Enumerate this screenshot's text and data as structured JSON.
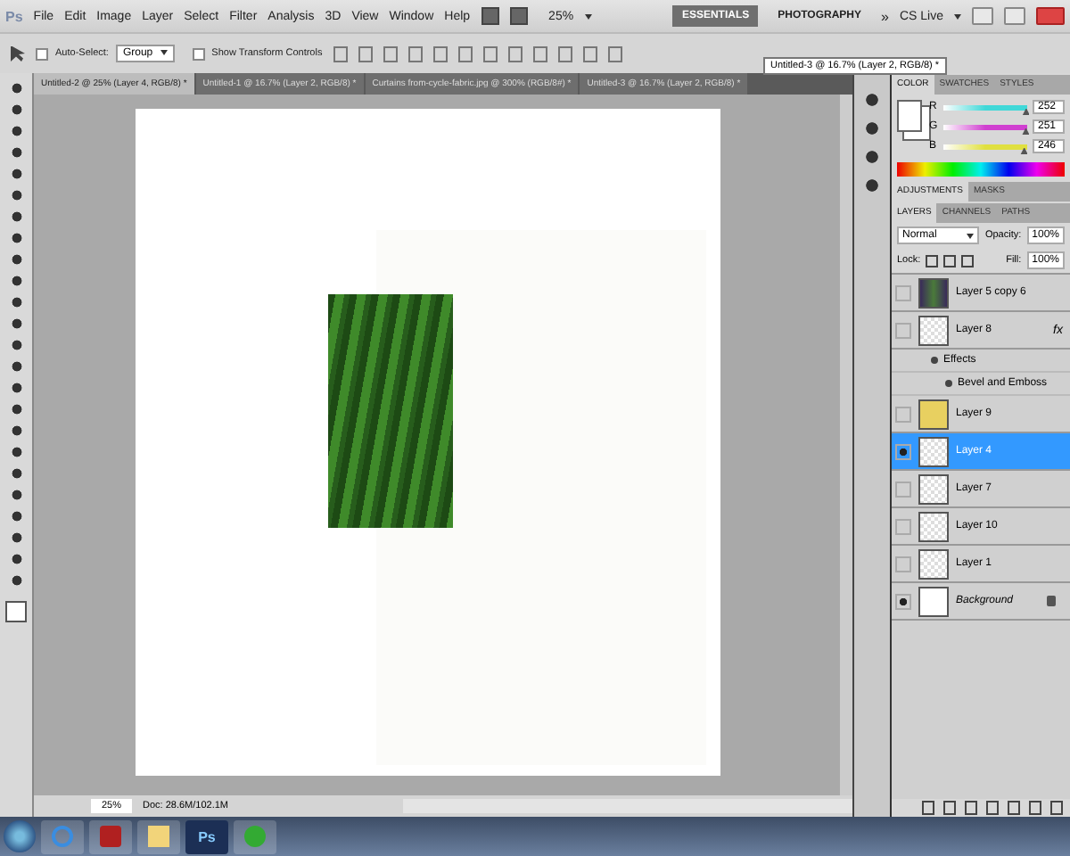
{
  "app_logo": "Ps",
  "menu": [
    "File",
    "Edit",
    "Image",
    "Layer",
    "Select",
    "Filter",
    "Analysis",
    "3D",
    "View",
    "Window",
    "Help"
  ],
  "zoom_menu": "25%",
  "workspaces": [
    {
      "label": "ESSENTIALS",
      "selected": true
    },
    {
      "label": "PHOTOGRAPHY",
      "selected": false
    }
  ],
  "more": "»",
  "cs_live": "CS Live",
  "options": {
    "auto_select": {
      "label": "Auto-Select:",
      "checked": false
    },
    "target": "Group",
    "transform": {
      "label": "Show Transform Controls",
      "checked": false
    }
  },
  "doc_tabs": [
    {
      "label": "Untitled-2 @ 25% (Layer 4, RGB/8) *",
      "selected": true
    },
    {
      "label": "Untitled-1 @ 16.7% (Layer 2, RGB/8) *",
      "selected": false
    },
    {
      "label": "Curtains from-cycle-fabric.jpg @ 300% (RGB/8#) *",
      "selected": false
    },
    {
      "label": "Untitled-3 @ 16.7% (Layer 2, RGB/8) *",
      "selected": false
    }
  ],
  "tooltip": "Untitled-3 @ 16.7% (Layer 2, RGB/8) *",
  "color_panel": {
    "tabs": [
      {
        "label": "COLOR",
        "selected": true
      },
      {
        "label": "SWATCHES",
        "selected": false
      },
      {
        "label": "STYLES",
        "selected": false
      }
    ],
    "channels": [
      {
        "name": "R",
        "level": 0.988,
        "reading": "252",
        "color": "#40d8d8"
      },
      {
        "name": "G",
        "level": 0.984,
        "reading": "251",
        "color": "#d040d0"
      },
      {
        "name": "B",
        "level": 0.965,
        "reading": "246",
        "color": "#e0e040"
      }
    ]
  },
  "adjust_tabs": [
    {
      "label": "ADJUSTMENTS",
      "selected": true
    },
    {
      "label": "MASKS",
      "selected": false
    }
  ],
  "layers_panel": {
    "tabs": [
      {
        "label": "LAYERS",
        "selected": true
      },
      {
        "label": "CHANNELS",
        "selected": false
      },
      {
        "label": "PATHS",
        "selected": false
      }
    ],
    "blend": "Normal",
    "opacity_label": "Opacity:",
    "opacity": "100%",
    "lock_label": "Lock:",
    "fill_label": "Fill:",
    "fill": "100%",
    "layers": [
      {
        "name": "Layer 5 copy 6",
        "kind": "photo",
        "visible": false,
        "selected": false,
        "locked": false
      },
      {
        "name": "Layer 8",
        "kind": "empty",
        "visible": false,
        "selected": false,
        "fx_label": "fx",
        "locked": false,
        "children": [
          {
            "name": "Effects"
          },
          {
            "name": "Bevel and Emboss"
          }
        ]
      },
      {
        "name": "Layer 9",
        "kind": "yellow",
        "visible": false,
        "selected": false,
        "locked": false
      },
      {
        "name": "Layer 4",
        "kind": "empty",
        "visible": true,
        "selected": true,
        "locked": false
      },
      {
        "name": "Layer 7",
        "kind": "empty",
        "visible": false,
        "selected": false,
        "locked": false
      },
      {
        "name": "Layer 10",
        "kind": "empty",
        "visible": false,
        "selected": false,
        "locked": false
      },
      {
        "name": "Layer 1",
        "kind": "empty",
        "visible": false,
        "selected": false,
        "locked": false
      },
      {
        "name": "Background",
        "kind": "white",
        "visible": true,
        "selected": false,
        "locked": true
      }
    ]
  },
  "status": {
    "zoom": "25%",
    "doc": "Doc: 28.6M/102.1M"
  },
  "taskbar": {
    "ps_label": "Ps"
  }
}
